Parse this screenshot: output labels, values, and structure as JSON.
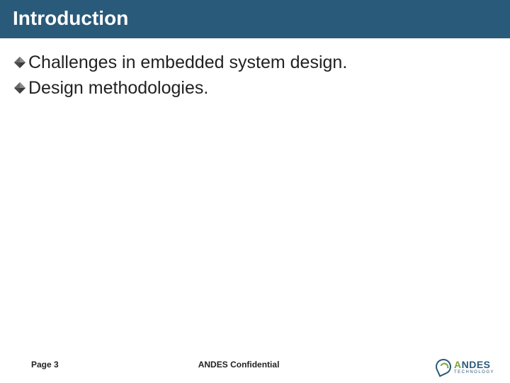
{
  "title": "Introduction",
  "bullets": [
    {
      "text": "Challenges in embedded system design."
    },
    {
      "text": "Design methodologies."
    }
  ],
  "footer": {
    "page": "Page 3",
    "confidential": "ANDES Confidential"
  },
  "logo": {
    "first": "A",
    "rest": "NDES",
    "sub": "TECHNOLOGY"
  }
}
